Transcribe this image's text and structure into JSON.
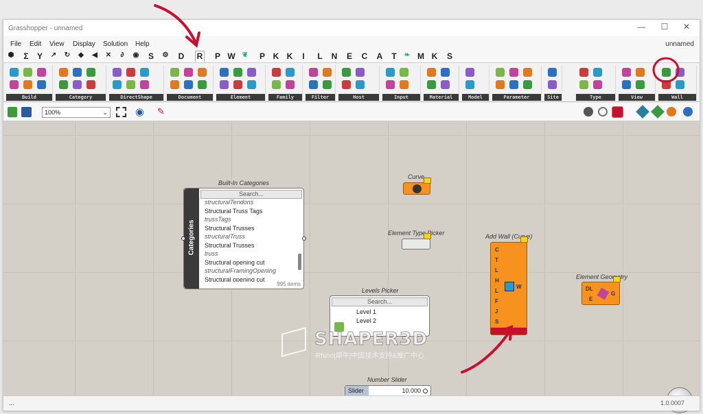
{
  "window": {
    "title": "Grasshopper - unnamed",
    "doc_name": "unnamed",
    "minimize": "—",
    "maximize": "☐",
    "close": "✕"
  },
  "menu": [
    "File",
    "Edit",
    "View",
    "Display",
    "Solution",
    "Help"
  ],
  "tabs": [
    "P",
    "W",
    "P",
    "K",
    "K",
    "I",
    "L",
    "N",
    "E",
    "C",
    "A",
    "T",
    "M",
    "K",
    "S"
  ],
  "tabs_left": [
    "Σ",
    "Y",
    "S",
    "D",
    "R"
  ],
  "ribbon_groups": [
    "Build",
    "Category",
    "DirectShape",
    "Document",
    "Element",
    "Family",
    "Filter",
    "Host",
    "Input",
    "Material",
    "Model",
    "Parameter",
    "Site",
    "Type",
    "View",
    "Wall"
  ],
  "toolbar": {
    "zoom": "100%"
  },
  "nodes": {
    "builtin_categories": {
      "caption": "Built-In Categories",
      "side_label": "Categories",
      "search": "Search...",
      "items": [
        {
          "name": "structuralTendons",
          "italic": true
        },
        {
          "name": "Structural Truss Tags",
          "italic": false
        },
        {
          "name": "trussTags",
          "italic": true
        },
        {
          "name": "Structural Trusses",
          "italic": false
        },
        {
          "name": "structuralTruss",
          "italic": true
        },
        {
          "name": "Structural Trusses",
          "italic": false
        },
        {
          "name": "truss",
          "italic": true
        },
        {
          "name": "Structural opening cut",
          "italic": false
        },
        {
          "name": "structuralFramingOpening",
          "italic": true
        },
        {
          "name": "Structural opening cut",
          "italic": false
        }
      ],
      "count": "995 items"
    },
    "curve": {
      "caption": "Curve"
    },
    "element_type_picker": {
      "caption": "Element Type Picker"
    },
    "add_wall": {
      "caption": "Add Wall (Curve)",
      "inputs": [
        "C",
        "T",
        "L",
        "H",
        "L",
        "F",
        "J",
        "S"
      ],
      "output": "W"
    },
    "element_geometry": {
      "caption": "Element Geometry",
      "inputs": [
        "DL",
        "E"
      ],
      "output": "G"
    },
    "levels_picker": {
      "caption": "Levels Picker",
      "search": "Search...",
      "items": [
        "Level 1",
        "Level 2"
      ]
    },
    "slider": {
      "caption": "Number Slider",
      "label": "Slider",
      "value": "10.000"
    }
  },
  "watermark": {
    "title": "SHAPER3D",
    "subtitle": "Rhino|犀牛|中国技术支持&推广中心"
  },
  "status": {
    "left": "...",
    "version": "1.0.0007"
  },
  "colors": {
    "node_orange": "#f7921e",
    "accent_red": "#c8102e",
    "canvas": "#d4d0c8"
  }
}
